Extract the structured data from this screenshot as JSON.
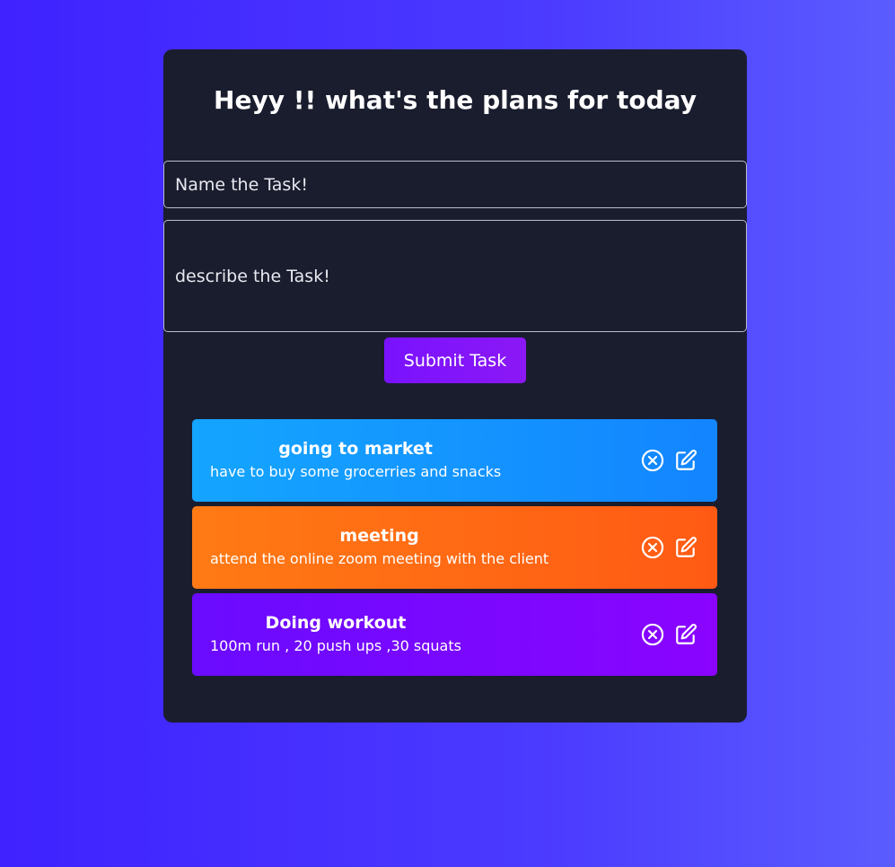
{
  "header": {
    "title": "Heyy !! what's the plans for today"
  },
  "form": {
    "name_placeholder": "Name the Task!",
    "description_placeholder": "describe the Task!",
    "submit_label": "Submit Task"
  },
  "tasks": [
    {
      "title": "going to market",
      "description": "have to buy some grocerries and snacks",
      "color": "#1395ff",
      "icons": [
        "close-circle-icon",
        "edit-icon"
      ]
    },
    {
      "title": "meeting",
      "description": "attend the online zoom meeting with the client",
      "color": "#ff6a14",
      "icons": [
        "close-circle-icon",
        "edit-icon"
      ]
    },
    {
      "title": "Doing workout",
      "description": "100m run , 20 push ups ,30 squats",
      "color": "#7a08ff",
      "icons": [
        "close-circle-icon",
        "edit-icon"
      ]
    }
  ],
  "colors": {
    "background_start": "#3f22ff",
    "background_end": "#5b5cff",
    "panel": "#1a1d2e",
    "submit_button": "#7a12ff"
  }
}
